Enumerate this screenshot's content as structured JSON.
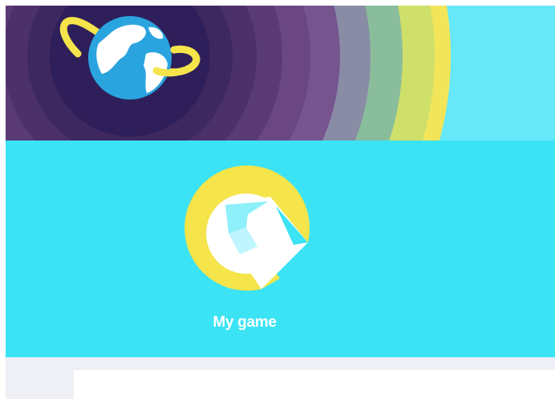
{
  "game": {
    "title": "My game",
    "logo_icon": "game-logo-icon"
  },
  "banner": {
    "logo_icon": "globe-orbit-icon"
  },
  "colors": {
    "banner_background": "#66e8f8",
    "panel_background": "#3be3f4",
    "accent_yellow": "#f5e44a",
    "globe_blue": "#2aa4df",
    "bottom_background": "#eef0f6"
  }
}
